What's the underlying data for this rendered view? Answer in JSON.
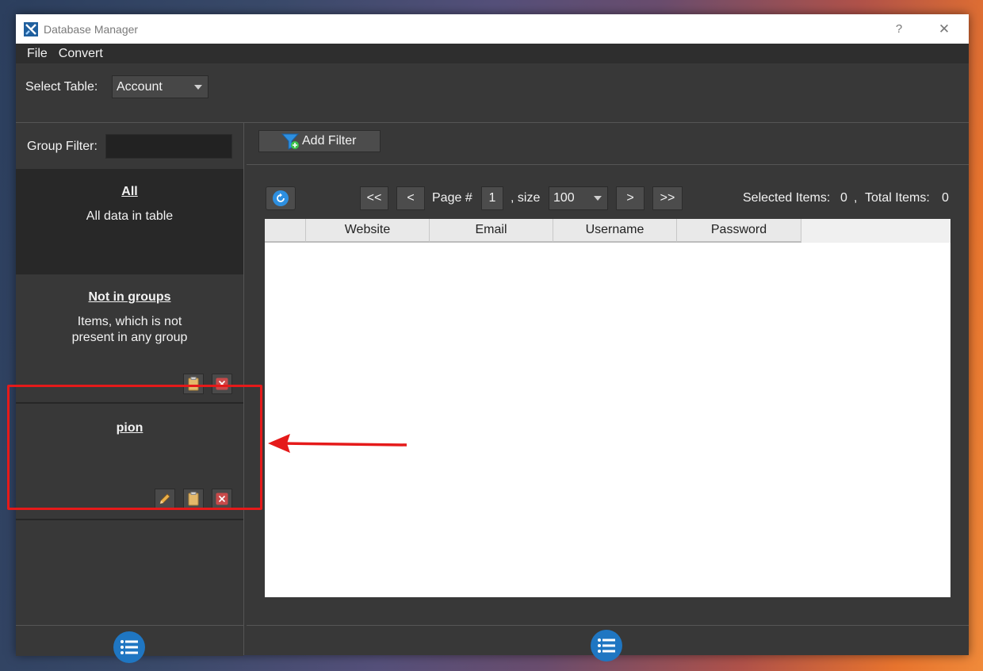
{
  "window": {
    "title": "Database Manager",
    "help_label": "?",
    "close_label": "✕"
  },
  "menu": {
    "items": [
      "File",
      "Convert"
    ]
  },
  "toolbar": {
    "select_table_label": "Select Table:",
    "table_value": "Account"
  },
  "left": {
    "group_filter_label": "Group Filter:",
    "group_filter_value": "",
    "groups": [
      {
        "title": "All",
        "desc": "All data in table"
      },
      {
        "title": "Not in groups",
        "desc_line1": "Items, which is not",
        "desc_line2": "present in any group"
      },
      {
        "title": "pion",
        "desc": ""
      }
    ]
  },
  "right": {
    "add_filter_label": "Add Filter",
    "first_label": "<<",
    "prev_label": "<",
    "page_label": "Page #",
    "page_value": "1",
    "size_label": ", size",
    "size_value": "100",
    "next_label": ">",
    "last_label": ">>",
    "selected_label": "Selected Items:",
    "selected_value": "0",
    "comma": ",",
    "total_label": "Total Items:",
    "total_value": "0",
    "columns": [
      "Website",
      "Email",
      "Username",
      "Password"
    ]
  },
  "colors": {
    "accent_blue": "#1f76c2",
    "annotation_red": "#e51a1a",
    "window_bg": "#383838"
  },
  "icons": [
    "app-icon",
    "refresh-icon",
    "filter-add-icon",
    "list-icon",
    "clipboard-icon",
    "delete-icon",
    "pencil-icon",
    "dropdown-arrow-icon"
  ]
}
